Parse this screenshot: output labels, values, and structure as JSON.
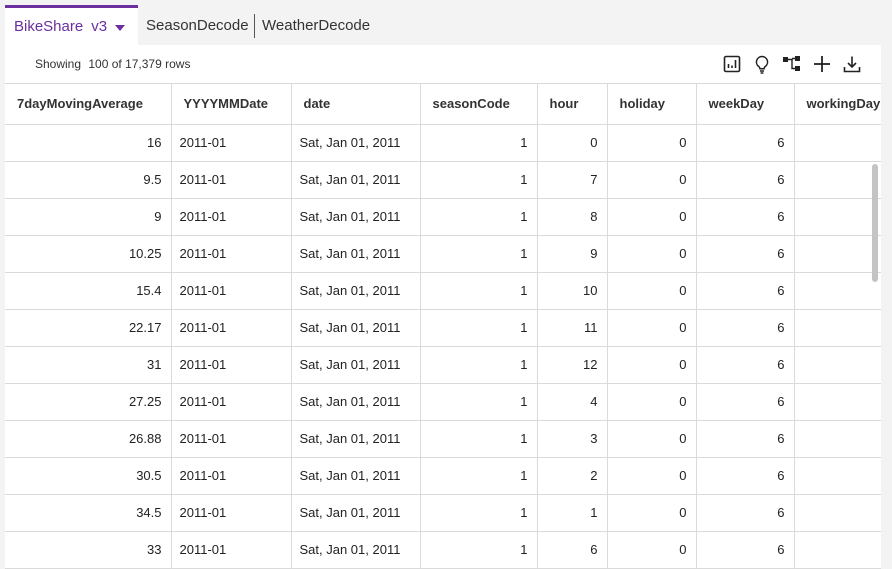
{
  "tabs": [
    {
      "label": "BikeShare",
      "version": "v3",
      "active": true
    },
    {
      "label": "SeasonDecode",
      "active": false
    },
    {
      "label": "WeatherDecode",
      "active": false
    }
  ],
  "toolbar": {
    "showing_label": "Showing",
    "row_count": "100 of 17,379 rows",
    "icons": [
      "chart-icon",
      "lightbulb-icon",
      "hierarchy-icon",
      "plus-icon",
      "download-icon"
    ]
  },
  "colors": {
    "accent": "#6b2fa0",
    "grid_line": "#dadada",
    "background": "#f3f3f4"
  },
  "columns": [
    "7dayMovingAverage",
    "YYYYMMDate",
    "date",
    "seasonCode",
    "hour",
    "holiday",
    "weekDay",
    "workingDay"
  ],
  "rows": [
    [
      "16",
      "2011-01",
      "Sat, Jan 01, 2011",
      "1",
      "0",
      "0",
      "6",
      ""
    ],
    [
      "9.5",
      "2011-01",
      "Sat, Jan 01, 2011",
      "1",
      "7",
      "0",
      "6",
      ""
    ],
    [
      "9",
      "2011-01",
      "Sat, Jan 01, 2011",
      "1",
      "8",
      "0",
      "6",
      ""
    ],
    [
      "10.25",
      "2011-01",
      "Sat, Jan 01, 2011",
      "1",
      "9",
      "0",
      "6",
      ""
    ],
    [
      "15.4",
      "2011-01",
      "Sat, Jan 01, 2011",
      "1",
      "10",
      "0",
      "6",
      ""
    ],
    [
      "22.17",
      "2011-01",
      "Sat, Jan 01, 2011",
      "1",
      "11",
      "0",
      "6",
      ""
    ],
    [
      "31",
      "2011-01",
      "Sat, Jan 01, 2011",
      "1",
      "12",
      "0",
      "6",
      ""
    ],
    [
      "27.25",
      "2011-01",
      "Sat, Jan 01, 2011",
      "1",
      "4",
      "0",
      "6",
      ""
    ],
    [
      "26.88",
      "2011-01",
      "Sat, Jan 01, 2011",
      "1",
      "3",
      "0",
      "6",
      ""
    ],
    [
      "30.5",
      "2011-01",
      "Sat, Jan 01, 2011",
      "1",
      "2",
      "0",
      "6",
      ""
    ],
    [
      "34.5",
      "2011-01",
      "Sat, Jan 01, 2011",
      "1",
      "1",
      "0",
      "6",
      ""
    ],
    [
      "33",
      "2011-01",
      "Sat, Jan 01, 2011",
      "1",
      "6",
      "0",
      "6",
      ""
    ]
  ]
}
